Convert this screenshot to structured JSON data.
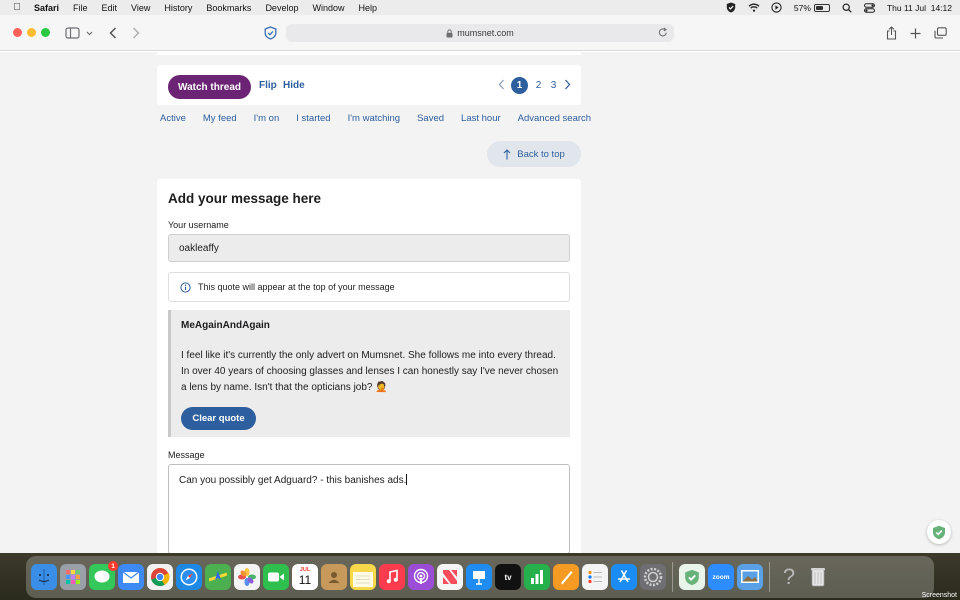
{
  "menubar": {
    "app_name": "Safari",
    "items": [
      "File",
      "Edit",
      "View",
      "History",
      "Bookmarks",
      "Develop",
      "Window",
      "Help"
    ],
    "battery_percent": "57%",
    "battery_level": 0.57,
    "datetime": "Thu 11 Jul  14:12"
  },
  "browser": {
    "url": "mumsnet.com"
  },
  "thread": {
    "watch_label": "Watch thread",
    "flip_label": "Flip",
    "hide_label": "Hide",
    "pages": [
      "1",
      "2",
      "3"
    ],
    "current_page": "1",
    "filters": [
      "Active",
      "My feed",
      "I'm on",
      "I started",
      "I'm watching",
      "Saved",
      "Last hour",
      "Advanced search"
    ],
    "back_to_top": "Back to top"
  },
  "form": {
    "title": "Add your message here",
    "username_label": "Your username",
    "username_value": "oakleaffy",
    "quote_note": "This quote will appear at the top of your message",
    "quote_author": "MeAgainAndAgain",
    "quote_text": "I feel like it's currently the only advert on Mumsnet. She follows me into every thread. In over 40 years of choosing glasses and lenses I can honestly say I've never chosen a lens by name. Isn't that the opticians job? 🤦",
    "clear_quote_label": "Clear quote",
    "message_label": "Message",
    "message_value": "Can you possibly get Adguard? - this banishes ads."
  },
  "dock": {
    "messages_badge": "1",
    "calendar_month": "JUL",
    "calendar_day": "11",
    "zoom_label": "zoom",
    "screenshot_label": "Screenshot",
    "colors": {
      "finder": "#3a8ee6",
      "launchpad": "#9aa0a8",
      "messages": "#34c759",
      "mail": "#3d8af7",
      "chrome": "#f2f2f2",
      "safari": "#1e88e5",
      "maps": "#4caf50",
      "photos": "#f4f4f4",
      "facetime": "#2fbf4f",
      "calendar": "#ffffff",
      "contacts": "#c79a5b",
      "notes": "#f7d84a",
      "music": "#fb3c4e",
      "podcasts": "#9b4dd8",
      "news": "#f5f5f5",
      "keynote": "#1f8cf2",
      "tv": "#111111",
      "numbers": "#26b04b",
      "pages": "#f59b24",
      "reminders": "#f4f4f4",
      "appstore": "#1c8cf5",
      "settings": "#6e6e73",
      "adguard": "#e9f5ea",
      "zoom": "#2d8cff",
      "preview": "#5aa0e6",
      "help": "#8e8e93",
      "trash": "#c8c8c8"
    }
  },
  "colors": {
    "purple": "#6b2473",
    "blue": "#2d5e9e"
  }
}
